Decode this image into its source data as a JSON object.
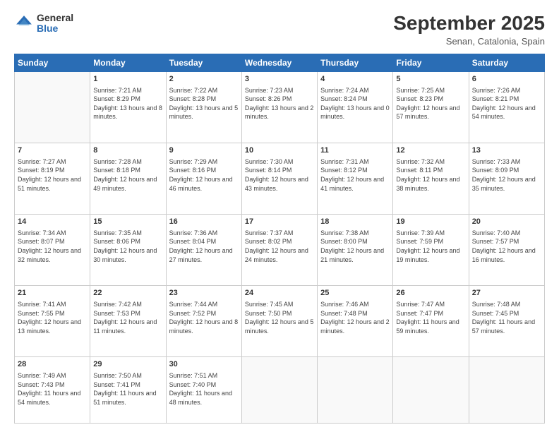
{
  "header": {
    "logo_line1": "General",
    "logo_line2": "Blue",
    "title": "September 2025",
    "subtitle": "Senan, Catalonia, Spain"
  },
  "weekdays": [
    "Sunday",
    "Monday",
    "Tuesday",
    "Wednesday",
    "Thursday",
    "Friday",
    "Saturday"
  ],
  "weeks": [
    [
      {
        "day": "",
        "sunrise": "",
        "sunset": "",
        "daylight": ""
      },
      {
        "day": "1",
        "sunrise": "Sunrise: 7:21 AM",
        "sunset": "Sunset: 8:29 PM",
        "daylight": "Daylight: 13 hours and 8 minutes."
      },
      {
        "day": "2",
        "sunrise": "Sunrise: 7:22 AM",
        "sunset": "Sunset: 8:28 PM",
        "daylight": "Daylight: 13 hours and 5 minutes."
      },
      {
        "day": "3",
        "sunrise": "Sunrise: 7:23 AM",
        "sunset": "Sunset: 8:26 PM",
        "daylight": "Daylight: 13 hours and 2 minutes."
      },
      {
        "day": "4",
        "sunrise": "Sunrise: 7:24 AM",
        "sunset": "Sunset: 8:24 PM",
        "daylight": "Daylight: 13 hours and 0 minutes."
      },
      {
        "day": "5",
        "sunrise": "Sunrise: 7:25 AM",
        "sunset": "Sunset: 8:23 PM",
        "daylight": "Daylight: 12 hours and 57 minutes."
      },
      {
        "day": "6",
        "sunrise": "Sunrise: 7:26 AM",
        "sunset": "Sunset: 8:21 PM",
        "daylight": "Daylight: 12 hours and 54 minutes."
      }
    ],
    [
      {
        "day": "7",
        "sunrise": "Sunrise: 7:27 AM",
        "sunset": "Sunset: 8:19 PM",
        "daylight": "Daylight: 12 hours and 51 minutes."
      },
      {
        "day": "8",
        "sunrise": "Sunrise: 7:28 AM",
        "sunset": "Sunset: 8:18 PM",
        "daylight": "Daylight: 12 hours and 49 minutes."
      },
      {
        "day": "9",
        "sunrise": "Sunrise: 7:29 AM",
        "sunset": "Sunset: 8:16 PM",
        "daylight": "Daylight: 12 hours and 46 minutes."
      },
      {
        "day": "10",
        "sunrise": "Sunrise: 7:30 AM",
        "sunset": "Sunset: 8:14 PM",
        "daylight": "Daylight: 12 hours and 43 minutes."
      },
      {
        "day": "11",
        "sunrise": "Sunrise: 7:31 AM",
        "sunset": "Sunset: 8:12 PM",
        "daylight": "Daylight: 12 hours and 41 minutes."
      },
      {
        "day": "12",
        "sunrise": "Sunrise: 7:32 AM",
        "sunset": "Sunset: 8:11 PM",
        "daylight": "Daylight: 12 hours and 38 minutes."
      },
      {
        "day": "13",
        "sunrise": "Sunrise: 7:33 AM",
        "sunset": "Sunset: 8:09 PM",
        "daylight": "Daylight: 12 hours and 35 minutes."
      }
    ],
    [
      {
        "day": "14",
        "sunrise": "Sunrise: 7:34 AM",
        "sunset": "Sunset: 8:07 PM",
        "daylight": "Daylight: 12 hours and 32 minutes."
      },
      {
        "day": "15",
        "sunrise": "Sunrise: 7:35 AM",
        "sunset": "Sunset: 8:06 PM",
        "daylight": "Daylight: 12 hours and 30 minutes."
      },
      {
        "day": "16",
        "sunrise": "Sunrise: 7:36 AM",
        "sunset": "Sunset: 8:04 PM",
        "daylight": "Daylight: 12 hours and 27 minutes."
      },
      {
        "day": "17",
        "sunrise": "Sunrise: 7:37 AM",
        "sunset": "Sunset: 8:02 PM",
        "daylight": "Daylight: 12 hours and 24 minutes."
      },
      {
        "day": "18",
        "sunrise": "Sunrise: 7:38 AM",
        "sunset": "Sunset: 8:00 PM",
        "daylight": "Daylight: 12 hours and 21 minutes."
      },
      {
        "day": "19",
        "sunrise": "Sunrise: 7:39 AM",
        "sunset": "Sunset: 7:59 PM",
        "daylight": "Daylight: 12 hours and 19 minutes."
      },
      {
        "day": "20",
        "sunrise": "Sunrise: 7:40 AM",
        "sunset": "Sunset: 7:57 PM",
        "daylight": "Daylight: 12 hours and 16 minutes."
      }
    ],
    [
      {
        "day": "21",
        "sunrise": "Sunrise: 7:41 AM",
        "sunset": "Sunset: 7:55 PM",
        "daylight": "Daylight: 12 hours and 13 minutes."
      },
      {
        "day": "22",
        "sunrise": "Sunrise: 7:42 AM",
        "sunset": "Sunset: 7:53 PM",
        "daylight": "Daylight: 12 hours and 11 minutes."
      },
      {
        "day": "23",
        "sunrise": "Sunrise: 7:44 AM",
        "sunset": "Sunset: 7:52 PM",
        "daylight": "Daylight: 12 hours and 8 minutes."
      },
      {
        "day": "24",
        "sunrise": "Sunrise: 7:45 AM",
        "sunset": "Sunset: 7:50 PM",
        "daylight": "Daylight: 12 hours and 5 minutes."
      },
      {
        "day": "25",
        "sunrise": "Sunrise: 7:46 AM",
        "sunset": "Sunset: 7:48 PM",
        "daylight": "Daylight: 12 hours and 2 minutes."
      },
      {
        "day": "26",
        "sunrise": "Sunrise: 7:47 AM",
        "sunset": "Sunset: 7:47 PM",
        "daylight": "Daylight: 11 hours and 59 minutes."
      },
      {
        "day": "27",
        "sunrise": "Sunrise: 7:48 AM",
        "sunset": "Sunset: 7:45 PM",
        "daylight": "Daylight: 11 hours and 57 minutes."
      }
    ],
    [
      {
        "day": "28",
        "sunrise": "Sunrise: 7:49 AM",
        "sunset": "Sunset: 7:43 PM",
        "daylight": "Daylight: 11 hours and 54 minutes."
      },
      {
        "day": "29",
        "sunrise": "Sunrise: 7:50 AM",
        "sunset": "Sunset: 7:41 PM",
        "daylight": "Daylight: 11 hours and 51 minutes."
      },
      {
        "day": "30",
        "sunrise": "Sunrise: 7:51 AM",
        "sunset": "Sunset: 7:40 PM",
        "daylight": "Daylight: 11 hours and 48 minutes."
      },
      {
        "day": "",
        "sunrise": "",
        "sunset": "",
        "daylight": ""
      },
      {
        "day": "",
        "sunrise": "",
        "sunset": "",
        "daylight": ""
      },
      {
        "day": "",
        "sunrise": "",
        "sunset": "",
        "daylight": ""
      },
      {
        "day": "",
        "sunrise": "",
        "sunset": "",
        "daylight": ""
      }
    ]
  ]
}
